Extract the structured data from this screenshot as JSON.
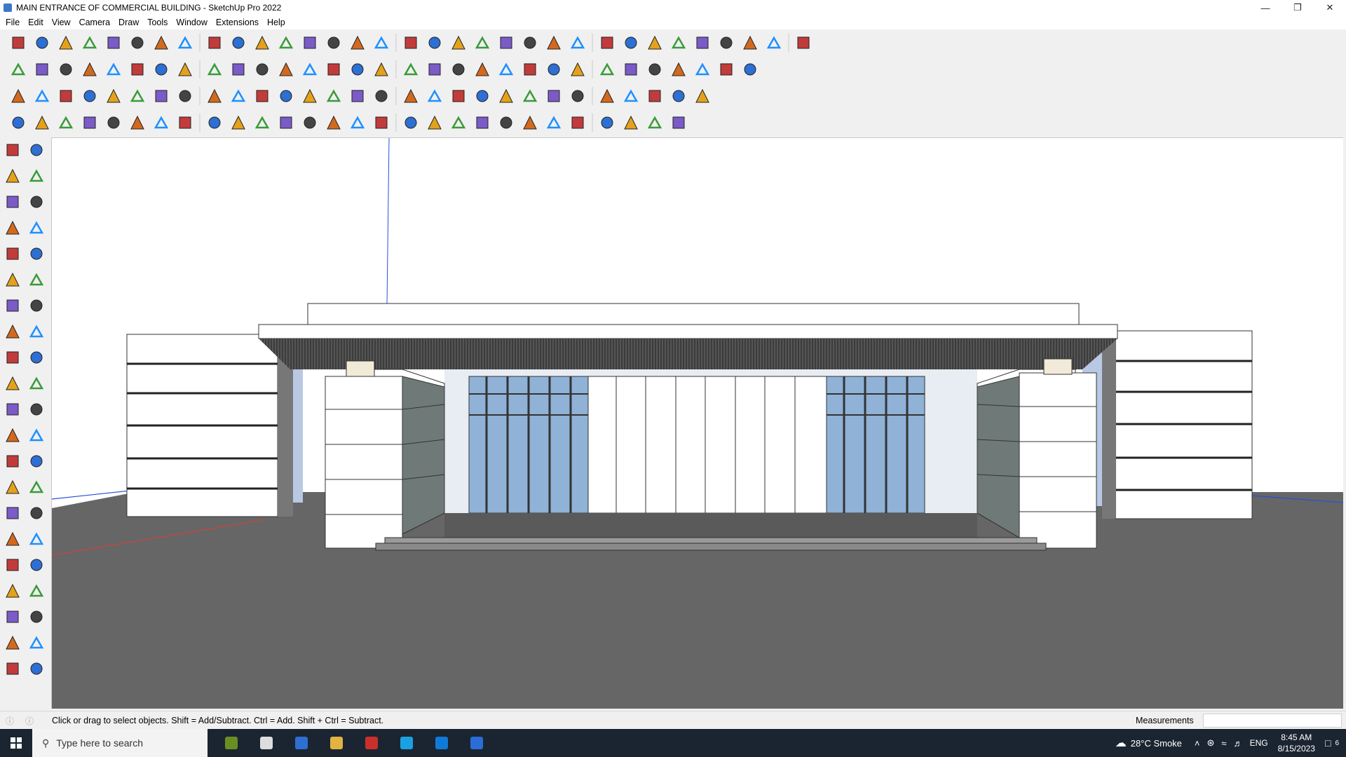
{
  "window": {
    "title": "MAIN ENTRANCE OF COMMERCIAL BUILDING - SketchUp Pro 2022",
    "minimize_icon": "minimize-icon",
    "restore_icon": "restore-icon",
    "close_icon": "close-icon"
  },
  "menu": {
    "items": [
      "File",
      "Edit",
      "View",
      "Camera",
      "Draw",
      "Tools",
      "Window",
      "Extensions",
      "Help"
    ]
  },
  "toolbars": {
    "row1": [
      "zoom-icon",
      "select-icon",
      "eraser-icon",
      "pencil-line-icon",
      "arc-icon",
      "rectangle-icon",
      "push-pull-icon",
      "follow-me-icon",
      "move-icon",
      "rotate-icon",
      "scale-icon",
      "tape-measure-icon",
      "text-icon",
      "paint-bucket-icon",
      "orbit-icon",
      "pan-icon",
      "zoom-window-icon",
      "zoom-extents-icon",
      "section-plane-icon",
      "tags-icon",
      "layers-icon",
      "component-icon",
      "camera-icon",
      "iso-view-icon",
      "top-view-icon",
      "front-view-icon",
      "right-view-icon",
      "back-view-icon",
      "left-view-icon",
      "bottom-view-icon",
      "xray-icon",
      "back-edges-icon",
      "wireframe-icon"
    ],
    "row2": [
      "cube-icon",
      "shaded-icon",
      "textured-icon",
      "monochrome-icon",
      "position-camera-icon",
      "walk-icon",
      "look-around-icon",
      "section-fill-icon",
      "axes-icon",
      "guides-icon",
      "shadows-icon",
      "fog-icon",
      "house-icon",
      "house-outline-icon",
      "warehouse-icon",
      "extension-icon",
      "sandbox-icon",
      "eraser-red-icon",
      "circle-icon",
      "polygon-icon",
      "ellipse-icon",
      "parallelogram-icon",
      "bezier-icon",
      "spline-icon",
      "rounded-icon",
      "offset-icon",
      "divide-icon",
      "measure-icon",
      "paint-icon",
      "texture-icon",
      "grid-icon"
    ],
    "row3": [
      "blue-plane-icon",
      "yellow-plane-icon",
      "tag-text-icon",
      "red-square-icon",
      "layer-icon",
      "window-frame-icon",
      "wood-icon",
      "chain-icon",
      "curve-icon",
      "dots-icon",
      "red-plus-icon",
      "green-plus-icon",
      "blue-x-icon",
      "cone-icon",
      "triangle-icon",
      "loop-icon",
      "spiral-icon",
      "axis-icon",
      "box-icon",
      "magnet-icon",
      "puzzle-icon",
      "box-3d-icon",
      "gear-box-icon",
      "grid-gold-icon",
      "bucket-icon",
      "lattice-icon",
      "scatter-icon",
      "freeform-icon",
      "frame-icon"
    ],
    "row4": [
      "line-node-icon",
      "curve-node-icon",
      "red-shape-icon",
      "loft-icon",
      "helix-icon",
      "sweep-icon",
      "roof-icon",
      "wall-icon",
      "stairs-icon",
      "rail-icon",
      "beam-icon",
      "column-icon",
      "slab-icon",
      "door-icon",
      "window-icon",
      "hatch-icon",
      "pattern-icon",
      "brick-icon",
      "tile-icon",
      "fence-icon",
      "grass-icon",
      "tree-icon",
      "leaf-icon",
      "plant-icon",
      "branch-icon",
      "comb-icon",
      "fan-icon",
      "star-icon"
    ]
  },
  "left_toolbar": {
    "tools": [
      "select-icon",
      "orbit-icon",
      "paint-bucket-icon",
      "eraser-icon",
      "component-icon",
      "tape-icon",
      "line-icon",
      "freehand-icon",
      "rectangle-icon",
      "rotated-rect-icon",
      "circle-icon",
      "polygon-icon",
      "arc-icon",
      "pie-icon",
      "arc3-icon",
      "arc-2pt-icon",
      "move-icon",
      "push-pull-icon",
      "rotate-icon",
      "follow-me-icon",
      "scale-icon",
      "offset-icon",
      "tape-measure-icon",
      "dimension-icon",
      "protractor-icon",
      "text-icon",
      "axes-icon",
      "3d-text-icon",
      "orbit-tool-icon",
      "pan-icon",
      "zoom-icon",
      "zoom-window-icon",
      "zoom-extents-icon",
      "previous-icon",
      "walk-icon",
      "look-around-icon",
      "footprint-icon",
      "position-camera-icon",
      "section-plane-icon",
      "display-section-icon",
      "section-cuts-icon",
      "section-fill-icon"
    ]
  },
  "viewport": {
    "model_name": "MAIN ENTRANCE OF COMMERCIAL BUILDING",
    "axis_colors": {
      "red": "#e23b3b",
      "blue": "#2b4fd6",
      "green": "#2ca02c"
    },
    "ground_color": "#666666",
    "glass_color": "#8fb2d6"
  },
  "status": {
    "hint": "Click or drag to select objects. Shift = Add/Subtract. Ctrl = Add. Shift + Ctrl = Subtract.",
    "measurements_label": "Measurements",
    "measurements_value": ""
  },
  "taskbar": {
    "search_placeholder": "Type here to search",
    "weather": "28°C  Smoke",
    "language": "ENG",
    "time": "8:45 AM",
    "date": "8/15/2023",
    "notification_count": "6",
    "apps": [
      "widgets-icon",
      "task-view-icon",
      "calculator-icon",
      "file-explorer-icon",
      "acrobat-icon",
      "sketchup-3-icon",
      "edge-icon",
      "sketchup-icon"
    ]
  }
}
